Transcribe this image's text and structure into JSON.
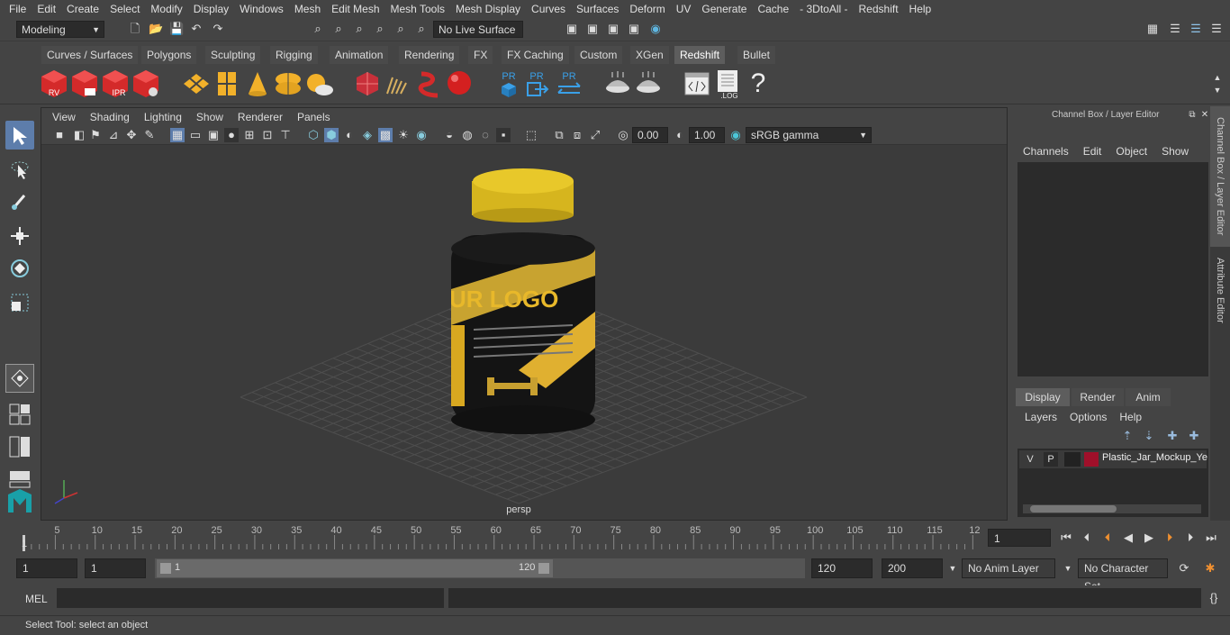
{
  "menubar": {
    "items": [
      "File",
      "Edit",
      "Create",
      "Select",
      "Modify",
      "Display",
      "Windows",
      "Mesh",
      "Edit Mesh",
      "Mesh Tools",
      "Mesh Display",
      "Curves",
      "Surfaces",
      "Deform",
      "UV",
      "Generate",
      "Cache",
      "- 3DtoAll -",
      "Redshift",
      "Help"
    ]
  },
  "statusline": {
    "mode": "Modeling",
    "live_surface": "No Live Surface"
  },
  "shelf": {
    "tabs": [
      "Curves / Surfaces",
      "Polygons",
      "Sculpting",
      "Rigging",
      "Animation",
      "Rendering",
      "FX",
      "FX Caching",
      "Custom",
      "XGen",
      "Redshift",
      "Bullet"
    ],
    "active_tab": "Redshift",
    "icon_labels": {
      "rv": "RV",
      "ipr": "IPR",
      "pr": "PR",
      "log": ".LOG",
      "help": "?"
    }
  },
  "viewport": {
    "menu": [
      "View",
      "Shading",
      "Lighting",
      "Show",
      "Renderer",
      "Panels"
    ],
    "exposure": "0.00",
    "gamma": "1.00",
    "color_space": "sRGB gamma",
    "camera_label": "persp",
    "label_text": "UR LOGO"
  },
  "channel_box": {
    "title": "Channel Box / Layer Editor",
    "menu": [
      "Channels",
      "Edit",
      "Object",
      "Show"
    ],
    "layer_tabs": [
      "Display",
      "Render",
      "Anim"
    ],
    "active_layer_tab": "Display",
    "layer_menu": [
      "Layers",
      "Options",
      "Help"
    ],
    "layer": {
      "v": "V",
      "p": "P",
      "name": "Plastic_Jar_Mockup_Ye",
      "color": "#a0102a"
    }
  },
  "side_tabs": [
    "Channel Box / Layer Editor",
    "Attribute Editor"
  ],
  "timeline": {
    "ticks": [
      "5",
      "10",
      "15",
      "20",
      "25",
      "30",
      "35",
      "40",
      "45",
      "50",
      "55",
      "60",
      "65",
      "70",
      "75",
      "80",
      "85",
      "90",
      "95",
      "100",
      "105",
      "110",
      "115",
      "12"
    ],
    "start_marker": "1",
    "current_frame": "1"
  },
  "range": {
    "start": "1",
    "playback_start": "1",
    "slider_start": "1",
    "slider_end": "120",
    "playback_end": "120",
    "end": "200",
    "anim_layer": "No Anim Layer",
    "character_set": "No Character Set"
  },
  "cmdline": {
    "label": "MEL"
  },
  "help": {
    "text": "Select Tool: select an object"
  },
  "colors": {
    "accent": "#5d7dab",
    "jar_cap": "#e2c021",
    "jar_body": "#1a1a1a"
  }
}
